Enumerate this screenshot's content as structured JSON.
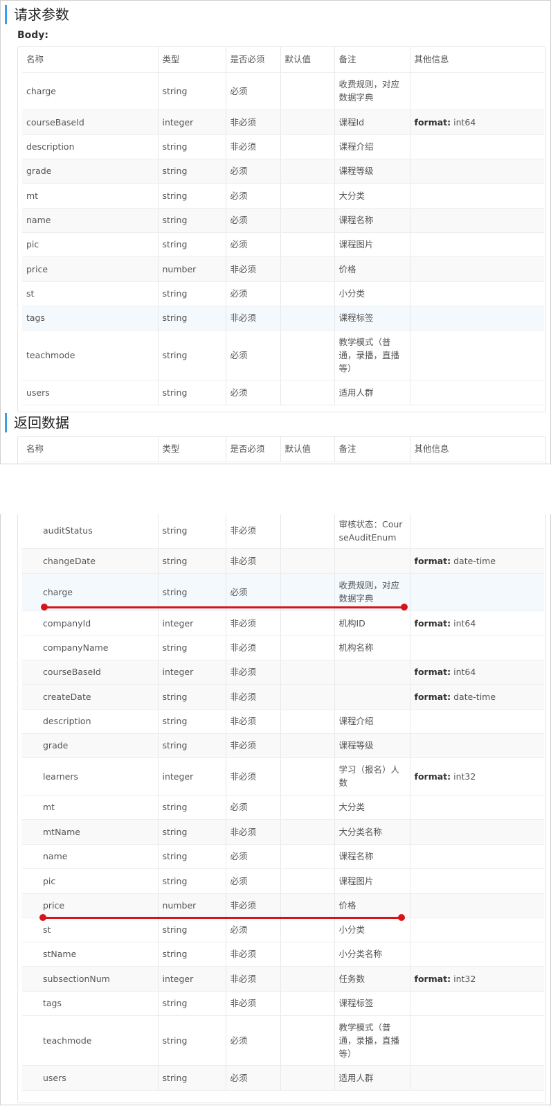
{
  "request": {
    "title": "请求参数",
    "body_label": "Body:",
    "headers": [
      "名称",
      "类型",
      "是否必须",
      "默认值",
      "备注",
      "其他信息"
    ],
    "rows": [
      {
        "name": "charge",
        "type": "string",
        "required": "必须",
        "default": "",
        "note": "收费规则，对应数据字典",
        "extra_key": "",
        "extra_val": ""
      },
      {
        "name": "courseBaseId",
        "type": "integer",
        "required": "非必须",
        "default": "",
        "note": "课程Id",
        "extra_key": "format:",
        "extra_val": "int64"
      },
      {
        "name": "description",
        "type": "string",
        "required": "非必须",
        "default": "",
        "note": "课程介绍",
        "extra_key": "",
        "extra_val": ""
      },
      {
        "name": "grade",
        "type": "string",
        "required": "必须",
        "default": "",
        "note": "课程等级",
        "extra_key": "",
        "extra_val": ""
      },
      {
        "name": "mt",
        "type": "string",
        "required": "必须",
        "default": "",
        "note": "大分类",
        "extra_key": "",
        "extra_val": ""
      },
      {
        "name": "name",
        "type": "string",
        "required": "必须",
        "default": "",
        "note": "课程名称",
        "extra_key": "",
        "extra_val": ""
      },
      {
        "name": "pic",
        "type": "string",
        "required": "必须",
        "default": "",
        "note": "课程图片",
        "extra_key": "",
        "extra_val": ""
      },
      {
        "name": "price",
        "type": "number",
        "required": "非必须",
        "default": "",
        "note": "价格",
        "extra_key": "",
        "extra_val": ""
      },
      {
        "name": "st",
        "type": "string",
        "required": "必须",
        "default": "",
        "note": "小分类",
        "extra_key": "",
        "extra_val": ""
      },
      {
        "name": "tags",
        "type": "string",
        "required": "非必须",
        "default": "",
        "note": "课程标签",
        "extra_key": "",
        "extra_val": ""
      },
      {
        "name": "teachmode",
        "type": "string",
        "required": "必须",
        "default": "",
        "note": "教学模式（普通，录播，直播等）",
        "extra_key": "",
        "extra_val": ""
      },
      {
        "name": "users",
        "type": "string",
        "required": "必须",
        "default": "",
        "note": "适用人群",
        "extra_key": "",
        "extra_val": ""
      }
    ]
  },
  "response": {
    "title": "返回数据",
    "headers": [
      "名称",
      "类型",
      "是否必须",
      "默认值",
      "备注",
      "其他信息"
    ],
    "rows": [
      {
        "name": "auditStatus",
        "type": "string",
        "required": "非必须",
        "default": "",
        "note": "审核状态：CourseAuditEnum",
        "extra_key": "",
        "extra_val": ""
      },
      {
        "name": "changeDate",
        "type": "string",
        "required": "非必须",
        "default": "",
        "note": "",
        "extra_key": "format:",
        "extra_val": "date-time"
      },
      {
        "name": "charge",
        "type": "string",
        "required": "必须",
        "default": "",
        "note": "收费规则，对应数据字典",
        "extra_key": "",
        "extra_val": ""
      },
      {
        "name": "companyId",
        "type": "integer",
        "required": "非必须",
        "default": "",
        "note": "机构ID",
        "extra_key": "format:",
        "extra_val": "int64"
      },
      {
        "name": "companyName",
        "type": "string",
        "required": "非必须",
        "default": "",
        "note": "机构名称",
        "extra_key": "",
        "extra_val": ""
      },
      {
        "name": "courseBaseId",
        "type": "integer",
        "required": "非必须",
        "default": "",
        "note": "",
        "extra_key": "format:",
        "extra_val": "int64"
      },
      {
        "name": "createDate",
        "type": "string",
        "required": "非必须",
        "default": "",
        "note": "",
        "extra_key": "format:",
        "extra_val": "date-time"
      },
      {
        "name": "description",
        "type": "string",
        "required": "非必须",
        "default": "",
        "note": "课程介绍",
        "extra_key": "",
        "extra_val": ""
      },
      {
        "name": "grade",
        "type": "string",
        "required": "非必须",
        "default": "",
        "note": "课程等级",
        "extra_key": "",
        "extra_val": ""
      },
      {
        "name": "learners",
        "type": "integer",
        "required": "非必须",
        "default": "",
        "note": "学习（报名）人数",
        "extra_key": "format:",
        "extra_val": "int32"
      },
      {
        "name": "mt",
        "type": "string",
        "required": "必须",
        "default": "",
        "note": "大分类",
        "extra_key": "",
        "extra_val": ""
      },
      {
        "name": "mtName",
        "type": "string",
        "required": "非必须",
        "default": "",
        "note": "大分类名称",
        "extra_key": "",
        "extra_val": ""
      },
      {
        "name": "name",
        "type": "string",
        "required": "必须",
        "default": "",
        "note": "课程名称",
        "extra_key": "",
        "extra_val": ""
      },
      {
        "name": "pic",
        "type": "string",
        "required": "必须",
        "default": "",
        "note": "课程图片",
        "extra_key": "",
        "extra_val": ""
      },
      {
        "name": "price",
        "type": "number",
        "required": "非必须",
        "default": "",
        "note": "价格",
        "extra_key": "",
        "extra_val": ""
      },
      {
        "name": "st",
        "type": "string",
        "required": "必须",
        "default": "",
        "note": "小分类",
        "extra_key": "",
        "extra_val": ""
      },
      {
        "name": "stName",
        "type": "string",
        "required": "非必须",
        "default": "",
        "note": "小分类名称",
        "extra_key": "",
        "extra_val": ""
      },
      {
        "name": "subsectionNum",
        "type": "integer",
        "required": "非必须",
        "default": "",
        "note": "任务数",
        "extra_key": "format:",
        "extra_val": "int32"
      },
      {
        "name": "tags",
        "type": "string",
        "required": "非必须",
        "default": "",
        "note": "课程标签",
        "extra_key": "",
        "extra_val": ""
      },
      {
        "name": "teachmode",
        "type": "string",
        "required": "必须",
        "default": "",
        "note": "教学模式（普通，录播，直播等）",
        "extra_key": "",
        "extra_val": ""
      },
      {
        "name": "users",
        "type": "string",
        "required": "必须",
        "default": "",
        "note": "适用人群",
        "extra_key": "",
        "extra_val": ""
      }
    ]
  },
  "colors": {
    "accent": "#3b9ee2",
    "annotation": "#d7141a"
  }
}
